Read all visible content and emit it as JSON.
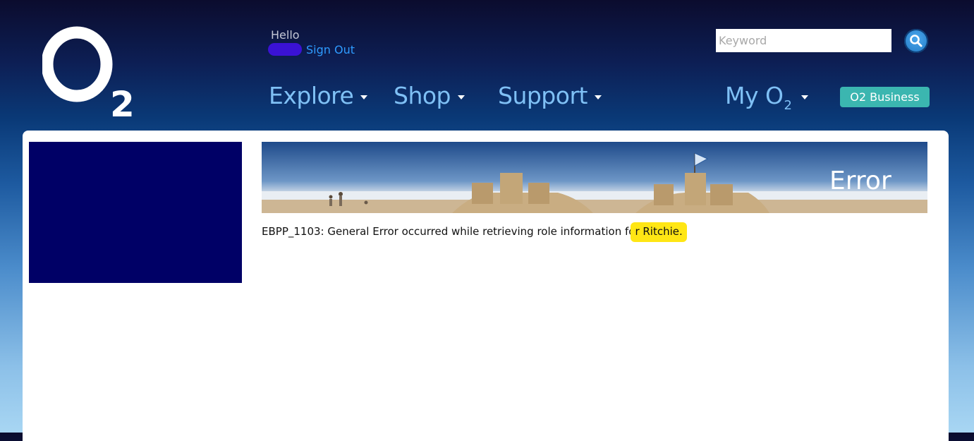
{
  "header": {
    "logo_alt": "O2",
    "greeting": "Hello",
    "sign_out_label": "Sign Out",
    "search": {
      "placeholder": "Keyword",
      "value": ""
    },
    "nav": [
      {
        "label": "Explore"
      },
      {
        "label": "Shop"
      },
      {
        "label": "Support"
      }
    ],
    "my_o2": {
      "label_main": "My O",
      "label_sub": "2"
    },
    "business_button": "O2 Business"
  },
  "main": {
    "banner_title": "Error",
    "error_prefix": "EBPP_1103: General Error occurred while retrieving role information fo",
    "error_highlight": "r Ritchie."
  },
  "colors": {
    "nav_text": "#7fc0f5",
    "sign_out": "#2e9bff",
    "business_button": "#3bb6b0",
    "side_block": "#000066",
    "highlight": "#ffe614"
  },
  "icons": [
    "o2-logo",
    "search-icon",
    "chevron-down-icon"
  ]
}
